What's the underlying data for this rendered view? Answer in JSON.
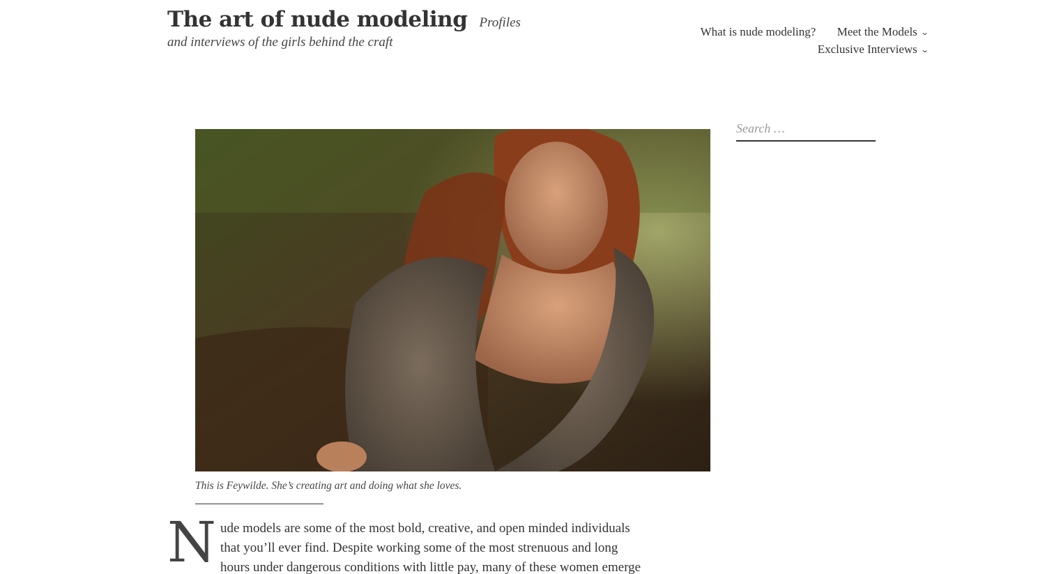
{
  "site": {
    "title": "The art of nude modeling",
    "description": "Profiles and interviews of the girls behind the craft"
  },
  "nav": {
    "items": [
      {
        "label": "What is nude modeling?",
        "has_submenu": false
      },
      {
        "label": "Meet the Models",
        "has_submenu": true
      },
      {
        "label": "Exclusive Interviews",
        "has_submenu": true
      }
    ],
    "submenu_icon": "chevron-down-icon"
  },
  "featured_image": {
    "caption": "This is Feywilde. She’s creating art and doing what she loves."
  },
  "article": {
    "dropcap": "N",
    "lines": [
      "ude models are some of the most bold, creative, and open minded individuals",
      "that you’ll ever find. Despite working some of the most strenuous and long",
      "hours under dangerous conditions with little pay, many of these women emerge"
    ]
  },
  "sidebar": {
    "search": {
      "placeholder": "Search …"
    }
  },
  "colors": {
    "text": "#333333",
    "muted": "#9a9a9a",
    "background": "#ffffff"
  }
}
